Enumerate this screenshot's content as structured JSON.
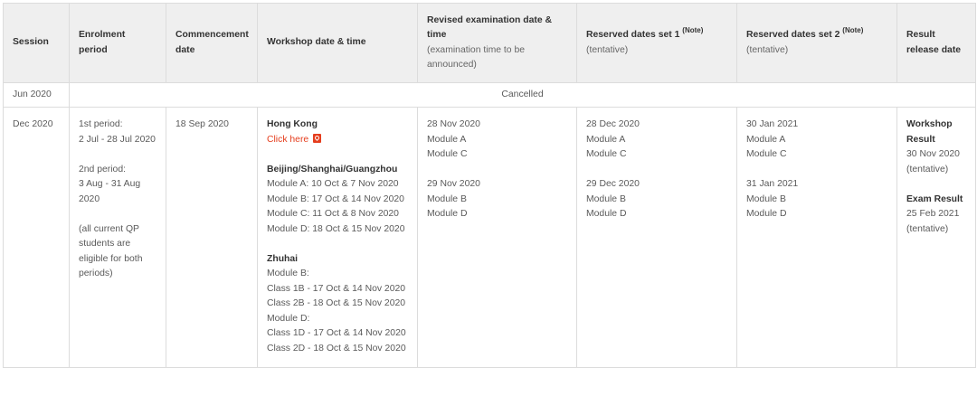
{
  "headers": {
    "session": "Session",
    "enrolment": "Enrolment period",
    "commencement": "Commencement date",
    "workshop": "Workshop date & time",
    "revised_title": "Revised examination date & time",
    "revised_sub": "(examination time to be announced)",
    "reserved1_title": "Reserved dates set 1",
    "reserved1_note": "(Note)",
    "reserved1_sub": "(tentative)",
    "reserved2_title": "Reserved dates set 2",
    "reserved2_note": "(Note)",
    "reserved2_sub": "(tentative)",
    "result": "Result release date"
  },
  "jun": {
    "session": "Jun 2020",
    "status": "Cancelled"
  },
  "dec": {
    "session": "Dec 2020",
    "enrolment": {
      "p1_label": "1st period:",
      "p1_dates": "2 Jul - 28 Jul 2020",
      "p2_label": "2nd period:",
      "p2_dates": "3 Aug - 31 Aug 2020",
      "note": "(all current QP students are eligible for both periods)"
    },
    "commencement": "18 Sep 2020",
    "workshop": {
      "hk_title": "Hong Kong",
      "hk_link": "Click here",
      "bsg_title": "Beijing/Shanghai/Guangzhou",
      "bsg_lines": [
        "Module A: 10 Oct & 7 Nov 2020",
        "Module B: 17 Oct & 14 Nov 2020",
        "Module C: 11 Oct & 8 Nov 2020",
        "Module D: 18 Oct & 15 Nov 2020"
      ],
      "zh_title": "Zhuhai",
      "zh_lines": [
        "Module B:",
        "Class 1B - 17 Oct & 14 Nov 2020",
        "Class 2B - 18 Oct & 15 Nov 2020",
        "Module D:",
        "Class 1D - 17 Oct & 14 Nov 2020",
        "Class 2D - 18 Oct & 15 Nov 2020"
      ]
    },
    "revised": {
      "d1": "28 Nov 2020",
      "d1_m1": "Module A",
      "d1_m2": "Module C",
      "d2": "29 Nov 2020",
      "d2_m1": "Module B",
      "d2_m2": "Module D"
    },
    "reserved1": {
      "d1": "28 Dec 2020",
      "d1_m1": "Module A",
      "d1_m2": "Module C",
      "d2": "29 Dec 2020",
      "d2_m1": "Module B",
      "d2_m2": "Module D"
    },
    "reserved2": {
      "d1": "30 Jan 2021",
      "d1_m1": "Module A",
      "d1_m2": "Module C",
      "d2": "31 Jan 2021",
      "d2_m1": "Module B",
      "d2_m2": "Module D"
    },
    "result": {
      "workshop_label": "Workshop Result",
      "workshop_date": "30 Nov 2020",
      "workshop_note": "(tentative)",
      "exam_label": "Exam Result",
      "exam_date": "25 Feb 2021",
      "exam_note": "(tentative)"
    }
  },
  "icons": {
    "pdf": "pdf-icon"
  },
  "colors": {
    "link": "#e53e1e",
    "header_bg": "#efefef",
    "border": "#dcdcdc"
  }
}
